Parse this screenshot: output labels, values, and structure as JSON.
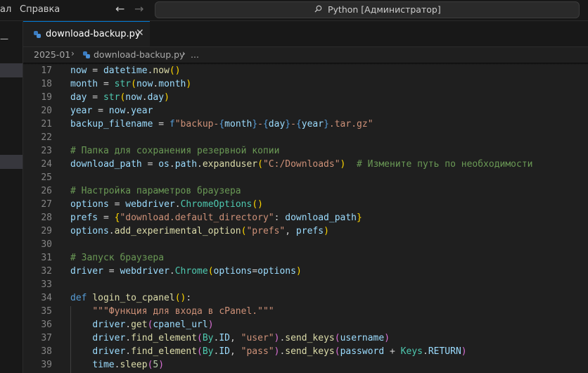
{
  "menu": {
    "items": [
      "ал",
      "Справка"
    ]
  },
  "search": {
    "text": "Python [Администратор]"
  },
  "tab": {
    "label": "download-backup.py",
    "close": "✕"
  },
  "breadcrumb": {
    "folder": "2025-01",
    "file": "download-backup.py",
    "more": "..."
  },
  "icons": {
    "back": "arrow-left-icon",
    "forward": "arrow-right-icon",
    "search": "search-icon",
    "file": "python-file-icon",
    "close": "close-icon"
  },
  "colors": {
    "accent": "#0078d4",
    "editor_bg": "#1f1f1f",
    "line_number": "#858585"
  },
  "code_lines": [
    {
      "n": "17",
      "tokens": [
        [
          "var",
          "now"
        ],
        [
          "txt",
          " = "
        ],
        [
          "var",
          "datetime"
        ],
        [
          "txt",
          "."
        ],
        [
          "fn",
          "now"
        ],
        [
          "br",
          "()"
        ]
      ]
    },
    {
      "n": "18",
      "tokens": [
        [
          "var",
          "month"
        ],
        [
          "txt",
          " = "
        ],
        [
          "cls",
          "str"
        ],
        [
          "br",
          "("
        ],
        [
          "var",
          "now"
        ],
        [
          "txt",
          "."
        ],
        [
          "var",
          "month"
        ],
        [
          "br",
          ")"
        ]
      ]
    },
    {
      "n": "19",
      "tokens": [
        [
          "var",
          "day"
        ],
        [
          "txt",
          " = "
        ],
        [
          "cls",
          "str"
        ],
        [
          "br",
          "("
        ],
        [
          "var",
          "now"
        ],
        [
          "txt",
          "."
        ],
        [
          "var",
          "day"
        ],
        [
          "br",
          ")"
        ]
      ]
    },
    {
      "n": "20",
      "tokens": [
        [
          "var",
          "year"
        ],
        [
          "txt",
          " = "
        ],
        [
          "var",
          "now"
        ],
        [
          "txt",
          "."
        ],
        [
          "var",
          "year"
        ]
      ]
    },
    {
      "n": "21",
      "tokens": [
        [
          "var",
          "backup_filename"
        ],
        [
          "txt",
          " = "
        ],
        [
          "kw",
          "f"
        ],
        [
          "str",
          "\"backup-"
        ],
        [
          "kw",
          "{"
        ],
        [
          "var",
          "month"
        ],
        [
          "kw",
          "}"
        ],
        [
          "str",
          "-"
        ],
        [
          "kw",
          "{"
        ],
        [
          "var",
          "day"
        ],
        [
          "kw",
          "}"
        ],
        [
          "str",
          "-"
        ],
        [
          "kw",
          "{"
        ],
        [
          "var",
          "year"
        ],
        [
          "kw",
          "}"
        ],
        [
          "str",
          ".tar.gz\""
        ]
      ]
    },
    {
      "n": "22",
      "tokens": []
    },
    {
      "n": "23",
      "tokens": [
        [
          "cmt",
          "# Папка для сохранения резервной копии"
        ]
      ]
    },
    {
      "n": "24",
      "tokens": [
        [
          "var",
          "download_path"
        ],
        [
          "txt",
          " = "
        ],
        [
          "var",
          "os"
        ],
        [
          "txt",
          "."
        ],
        [
          "var",
          "path"
        ],
        [
          "txt",
          "."
        ],
        [
          "fn",
          "expanduser"
        ],
        [
          "br",
          "("
        ],
        [
          "str",
          "\"C:/Downloads\""
        ],
        [
          "br",
          ")"
        ],
        [
          "txt",
          "  "
        ],
        [
          "cmt",
          "# Измените путь по необходимости"
        ]
      ]
    },
    {
      "n": "25",
      "tokens": []
    },
    {
      "n": "26",
      "tokens": [
        [
          "cmt",
          "# Настройка параметров браузера"
        ]
      ]
    },
    {
      "n": "27",
      "tokens": [
        [
          "var",
          "options"
        ],
        [
          "txt",
          " = "
        ],
        [
          "var",
          "webdriver"
        ],
        [
          "txt",
          "."
        ],
        [
          "cls",
          "ChromeOptions"
        ],
        [
          "br",
          "()"
        ]
      ]
    },
    {
      "n": "28",
      "tokens": [
        [
          "var",
          "prefs"
        ],
        [
          "txt",
          " = "
        ],
        [
          "br",
          "{"
        ],
        [
          "str",
          "\"download.default_directory\""
        ],
        [
          "txt",
          ": "
        ],
        [
          "var",
          "download_path"
        ],
        [
          "br",
          "}"
        ]
      ]
    },
    {
      "n": "29",
      "tokens": [
        [
          "var",
          "options"
        ],
        [
          "txt",
          "."
        ],
        [
          "fn",
          "add_experimental_option"
        ],
        [
          "br",
          "("
        ],
        [
          "str",
          "\"prefs\""
        ],
        [
          "txt",
          ", "
        ],
        [
          "var",
          "prefs"
        ],
        [
          "br",
          ")"
        ]
      ]
    },
    {
      "n": "30",
      "tokens": []
    },
    {
      "n": "31",
      "tokens": [
        [
          "cmt",
          "# Запуск браузера"
        ]
      ]
    },
    {
      "n": "32",
      "tokens": [
        [
          "var",
          "driver"
        ],
        [
          "txt",
          " = "
        ],
        [
          "var",
          "webdriver"
        ],
        [
          "txt",
          "."
        ],
        [
          "cls",
          "Chrome"
        ],
        [
          "br",
          "("
        ],
        [
          "var",
          "options"
        ],
        [
          "txt",
          "="
        ],
        [
          "var",
          "options"
        ],
        [
          "br",
          ")"
        ]
      ]
    },
    {
      "n": "33",
      "tokens": []
    },
    {
      "n": "34",
      "tokens": [
        [
          "kw",
          "def"
        ],
        [
          "txt",
          " "
        ],
        [
          "fn",
          "login_to_cpanel"
        ],
        [
          "br",
          "()"
        ],
        [
          "txt",
          ":"
        ]
      ]
    },
    {
      "n": "35",
      "tokens": [
        [
          "txt",
          "    "
        ],
        [
          "str",
          "\"\"\"Функция для входа в cPanel.\"\"\""
        ]
      ]
    },
    {
      "n": "36",
      "tokens": [
        [
          "txt",
          "    "
        ],
        [
          "var",
          "driver"
        ],
        [
          "txt",
          "."
        ],
        [
          "fn",
          "get"
        ],
        [
          "pb",
          "("
        ],
        [
          "var",
          "cpanel_url"
        ],
        [
          "pb",
          ")"
        ]
      ]
    },
    {
      "n": "37",
      "tokens": [
        [
          "txt",
          "    "
        ],
        [
          "var",
          "driver"
        ],
        [
          "txt",
          "."
        ],
        [
          "fn",
          "find_element"
        ],
        [
          "pb",
          "("
        ],
        [
          "cls",
          "By"
        ],
        [
          "txt",
          "."
        ],
        [
          "var",
          "ID"
        ],
        [
          "txt",
          ", "
        ],
        [
          "str",
          "\"user\""
        ],
        [
          "pb",
          ")"
        ],
        [
          "txt",
          "."
        ],
        [
          "fn",
          "send_keys"
        ],
        [
          "pb",
          "("
        ],
        [
          "var",
          "username"
        ],
        [
          "pb",
          ")"
        ]
      ]
    },
    {
      "n": "38",
      "tokens": [
        [
          "txt",
          "    "
        ],
        [
          "var",
          "driver"
        ],
        [
          "txt",
          "."
        ],
        [
          "fn",
          "find_element"
        ],
        [
          "pb",
          "("
        ],
        [
          "cls",
          "By"
        ],
        [
          "txt",
          "."
        ],
        [
          "var",
          "ID"
        ],
        [
          "txt",
          ", "
        ],
        [
          "str",
          "\"pass\""
        ],
        [
          "pb",
          ")"
        ],
        [
          "txt",
          "."
        ],
        [
          "fn",
          "send_keys"
        ],
        [
          "pb",
          "("
        ],
        [
          "var",
          "password"
        ],
        [
          "txt",
          " + "
        ],
        [
          "cls",
          "Keys"
        ],
        [
          "txt",
          "."
        ],
        [
          "var",
          "RETURN"
        ],
        [
          "pb",
          ")"
        ]
      ]
    },
    {
      "n": "39",
      "tokens": [
        [
          "txt",
          "    "
        ],
        [
          "var",
          "time"
        ],
        [
          "txt",
          "."
        ],
        [
          "fn",
          "sleep"
        ],
        [
          "pb",
          "("
        ],
        [
          "num",
          "5"
        ],
        [
          "pb",
          ")"
        ]
      ]
    }
  ]
}
